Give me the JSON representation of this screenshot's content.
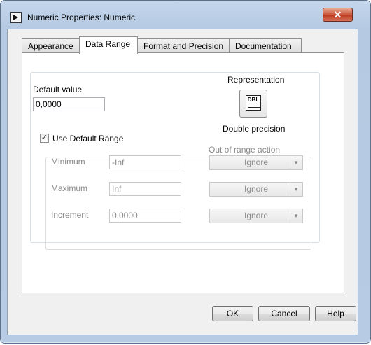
{
  "window": {
    "title": "Numeric Properties: Numeric",
    "close_glyph": "✕"
  },
  "tabs": [
    {
      "label": "Appearance"
    },
    {
      "label": "Data Range"
    },
    {
      "label": "Format and Precision"
    },
    {
      "label": "Documentation"
    }
  ],
  "active_tab": "Data Range",
  "default_value": {
    "label": "Default value",
    "value": "0,0000"
  },
  "representation": {
    "label": "Representation",
    "icon_text": "DBL",
    "type": "Double precision"
  },
  "use_default_range": {
    "label": "Use Default Range",
    "checked": true,
    "check_glyph": "✓"
  },
  "range": {
    "action_header": "Out of range action",
    "rows": [
      {
        "label": "Minimum",
        "value": "-Inf",
        "action": "Ignore"
      },
      {
        "label": "Maximum",
        "value": "Inf",
        "action": "Ignore"
      },
      {
        "label": "Increment",
        "value": "0,0000",
        "action": "Ignore"
      }
    ],
    "arrow_glyph": "▼"
  },
  "buttons": {
    "ok": "OK",
    "cancel": "Cancel",
    "help": "Help"
  }
}
